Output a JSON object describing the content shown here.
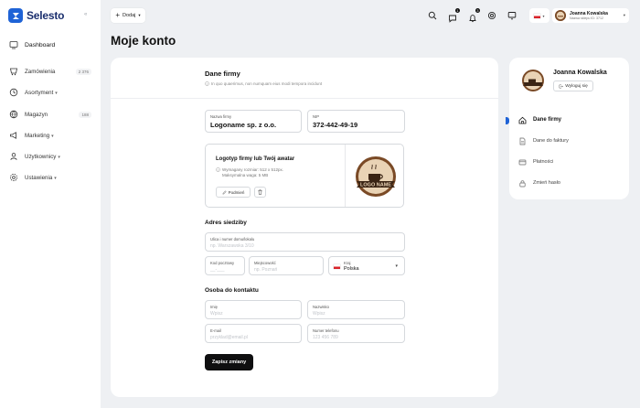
{
  "app": {
    "brand": "Selesto",
    "collapse_label": "«"
  },
  "sidebar": {
    "items": [
      {
        "label": "Dashboard",
        "icon": "dashboard-icon",
        "badge": "",
        "caret": false
      },
      {
        "label": "Zamówienia",
        "icon": "orders-icon",
        "badge": "2 376",
        "caret": false
      },
      {
        "label": "Asortyment",
        "icon": "assortment-icon",
        "badge": "",
        "caret": true
      },
      {
        "label": "Magazyn",
        "icon": "warehouse-icon",
        "badge": "188",
        "caret": false
      },
      {
        "label": "Marketing",
        "icon": "marketing-icon",
        "badge": "",
        "caret": true
      },
      {
        "label": "Użytkownicy",
        "icon": "users-icon",
        "badge": "",
        "caret": true
      },
      {
        "label": "Ustawienia",
        "icon": "settings-icon",
        "badge": "",
        "caret": true
      }
    ]
  },
  "topbar": {
    "add_label": "Dodaj",
    "notifications": [
      {
        "count": "1"
      },
      {
        "count": "3"
      }
    ],
    "user_name": "Joanna Kowalska",
    "user_store": "Nazwa sklepu ID: 3712"
  },
  "page_title": "Moje konto",
  "company": {
    "title": "Dane firmy",
    "subtitle": "In quo quaerimus, non numquam eius modi tempora incidunt",
    "name_label": "Nazwa firmy",
    "name_value": "Logoname sp. z o.o.",
    "nip_label": "NIP",
    "nip_value": "372-442-49-19",
    "logo_title": "Logotyp firmy lub Twój awatar",
    "logo_req_line1": "Wymagany rozmiar: 512 x 512px.",
    "logo_req_line2": "Maksymalna waga: 5 MB",
    "upload_label": "Podmień",
    "logo_text": "LOGO NAME"
  },
  "address": {
    "title": "Adres siedziby",
    "street_label": "Ulica i numer domu/lokalu",
    "street_placeholder": "np. Warszawska 3/10",
    "zip_label": "Kod pocztowy",
    "zip_placeholder": "__-___",
    "city_label": "Miejscowość",
    "city_placeholder": "np. Poznań",
    "country_label": "Kraj",
    "country_value": "Polska"
  },
  "contact": {
    "title": "Osoba do kontaktu",
    "first_label": "Imię",
    "first_placeholder": "Wpisz",
    "last_label": "Nazwisko",
    "last_placeholder": "Wpisz",
    "email_label": "E-mail",
    "email_placeholder": "przyklad@email.pl",
    "phone_label": "Numer telefonu",
    "phone_placeholder": "123 456 789"
  },
  "save_label": "Zapisz zmiany",
  "account_panel": {
    "name": "Joanna Kowalska",
    "logout_label": "Wyloguj się",
    "items": [
      {
        "label": "Dane firmy",
        "icon": "company-icon",
        "active": true
      },
      {
        "label": "Dane do faktury",
        "icon": "invoice-icon",
        "active": false
      },
      {
        "label": "Płatności",
        "icon": "payments-icon",
        "active": false
      },
      {
        "label": "Zmień hasło",
        "icon": "lock-icon",
        "active": false
      }
    ]
  },
  "colors": {
    "accent": "#1f63d6",
    "primary_button": "#0f0f10",
    "background": "#eef0f3"
  }
}
